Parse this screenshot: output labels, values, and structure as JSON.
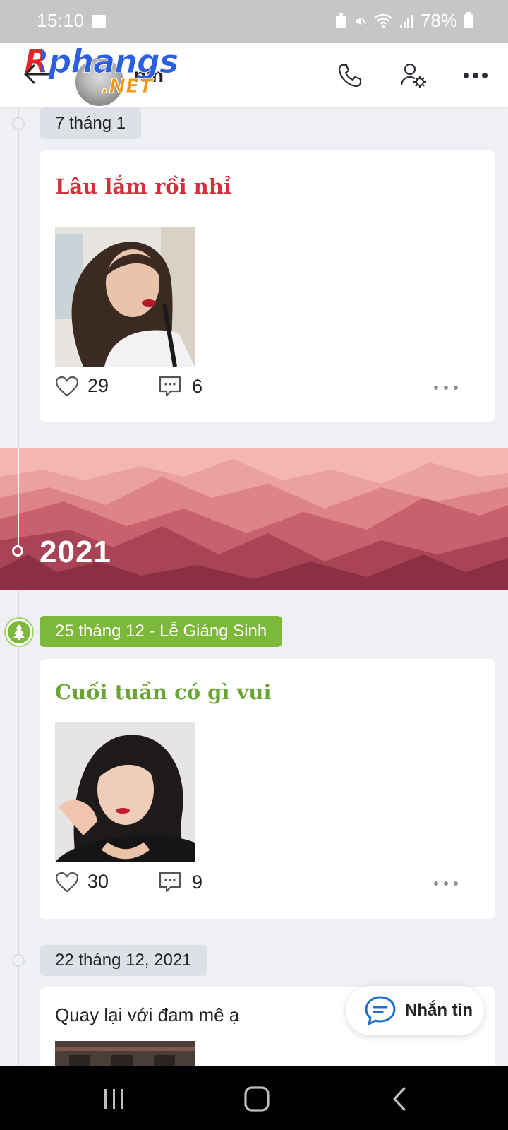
{
  "status_bar": {
    "time": "15:10",
    "battery": "78%"
  },
  "header": {
    "name_partial": "nin",
    "watermark_top": "Rphangs",
    "watermark_bottom": ".NET"
  },
  "timeline": [
    {
      "date_label": "7 tháng 1",
      "title": "Lâu lắm rồi nhỉ",
      "title_color": "#d3303a",
      "likes": "29",
      "comments": "6"
    },
    {
      "date_label": "25 tháng 12 - Lễ Giáng Sinh",
      "chip_color": "#7cb83a",
      "title": "Cuối tuần có gì vui",
      "title_color": "#6aa434",
      "likes": "30",
      "comments": "9"
    },
    {
      "date_label": "22 tháng 12, 2021",
      "title": "Quay lại với đam mê ạ"
    }
  ],
  "year_banner": {
    "year": "2021"
  },
  "fab": {
    "label": "Nhắn tin"
  },
  "icons": {
    "back": "back-arrow-icon",
    "call": "phone-icon",
    "settings": "user-settings-icon",
    "more": "more-icon",
    "like": "heart-icon",
    "comment": "comment-icon",
    "tree": "christmas-tree-icon",
    "message": "chat-bubble-icon"
  }
}
